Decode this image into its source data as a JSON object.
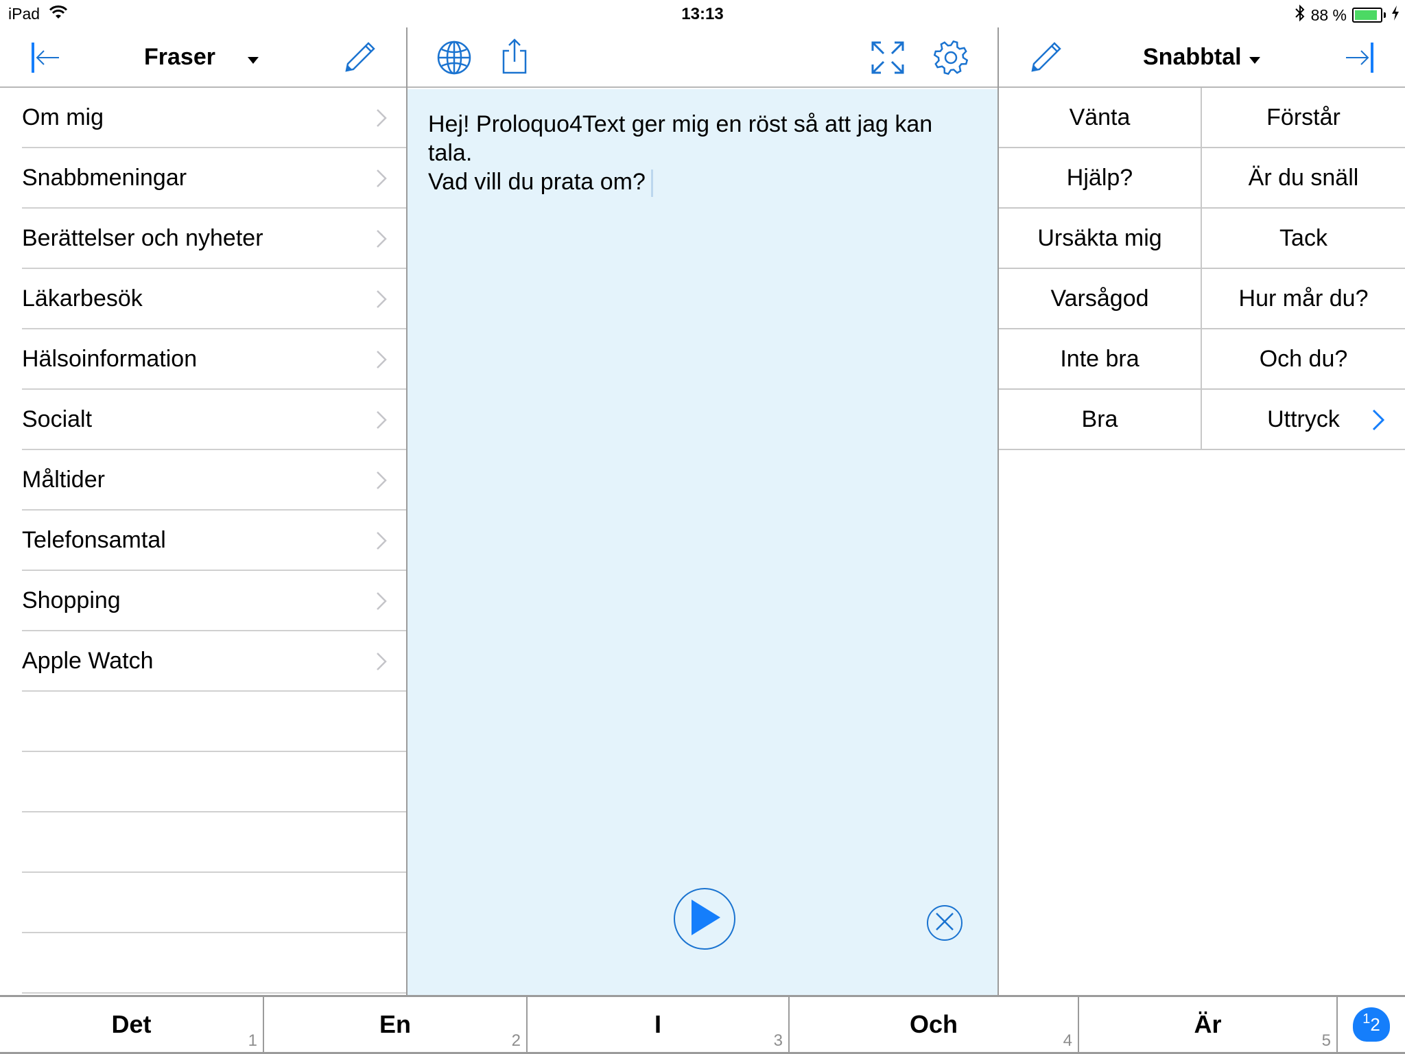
{
  "status_bar": {
    "device": "iPad",
    "time": "13:13",
    "battery_percent_label": "88 %",
    "battery_level": 0.88,
    "icons": [
      "wifi-icon",
      "bluetooth-icon",
      "battery-icon",
      "charging-bolt-icon"
    ]
  },
  "left_panel": {
    "title": "Fraser",
    "collapse_icon": "arrow-left-to-bar-icon",
    "edit_icon": "pencil-icon",
    "items": [
      {
        "label": "Om mig"
      },
      {
        "label": "Snabbmeningar"
      },
      {
        "label": "Berättelser och nyheter"
      },
      {
        "label": "Läkarbesök"
      },
      {
        "label": "Hälsoinformation"
      },
      {
        "label": "Socialt"
      },
      {
        "label": "Måltider"
      },
      {
        "label": "Telefonsamtal"
      },
      {
        "label": "Shopping"
      },
      {
        "label": "Apple Watch"
      }
    ]
  },
  "middle_panel": {
    "toolbar_icons": [
      "globe-icon",
      "share-icon",
      "expand-icon",
      "gear-icon"
    ],
    "text_lines": [
      "Hej! Proloquo4Text ger mig en röst så att jag kan",
      "tala.",
      "Vad vill du prata om?"
    ],
    "accent_color": "#157efb",
    "background_color": "#e4f3fb"
  },
  "right_panel": {
    "title": "Snabbtal",
    "edit_icon": "pencil-icon",
    "expand_icon": "arrow-right-to-bar-icon",
    "cells": [
      {
        "label": "Vänta"
      },
      {
        "label": "Förstår"
      },
      {
        "label": "Hjälp?"
      },
      {
        "label": "Är du snäll"
      },
      {
        "label": "Ursäkta mig"
      },
      {
        "label": "Tack"
      },
      {
        "label": "Varsågod"
      },
      {
        "label": "Hur mår du?"
      },
      {
        "label": "Inte bra"
      },
      {
        "label": "Och du?"
      },
      {
        "label": "Bra"
      },
      {
        "label": "Uttryck",
        "has_submenu": true
      }
    ]
  },
  "word_prediction": {
    "words": [
      {
        "word": "Det",
        "num": "1"
      },
      {
        "word": "En",
        "num": "2"
      },
      {
        "word": "I",
        "num": "3"
      },
      {
        "word": "Och",
        "num": "4"
      },
      {
        "word": "Är",
        "num": "5"
      }
    ],
    "numpad_label_sup": "1",
    "numpad_label_main": "2"
  }
}
